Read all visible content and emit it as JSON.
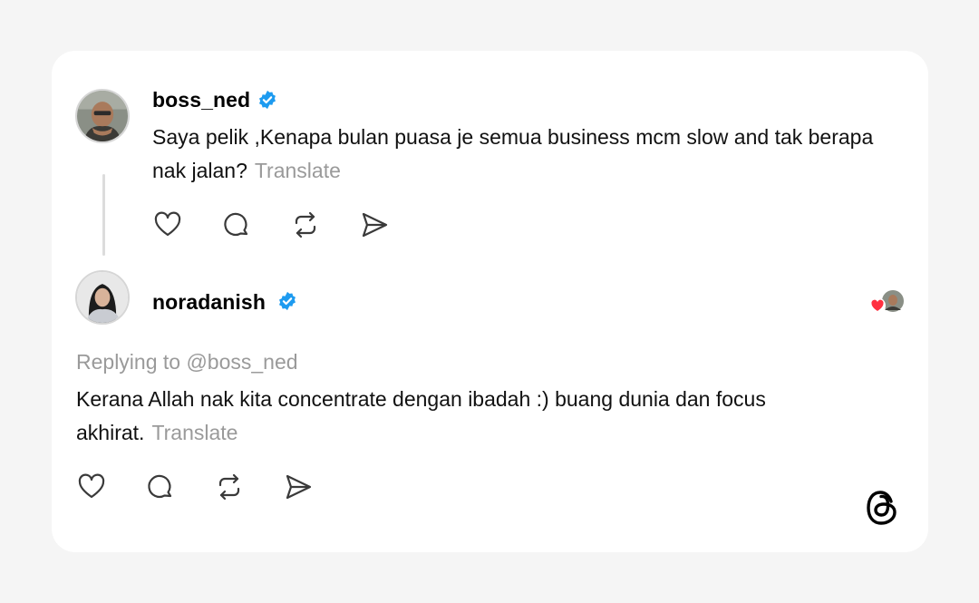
{
  "post": {
    "author": "boss_ned",
    "text": "Saya pelik ,Kenapa bulan puasa je semua business mcm slow and tak berapa nak jalan?",
    "translate_label": "Translate"
  },
  "reply": {
    "author": "noradanish",
    "replying_to": "Replying to @boss_ned",
    "text": "Kerana Allah nak kita concentrate dengan ibadah :) buang dunia dan focus akhirat.",
    "translate_label": "Translate"
  },
  "icons": {
    "verified": "verified-badge-icon",
    "like": "heart-icon",
    "comment": "comment-bubble-icon",
    "repost": "repost-icon",
    "share": "send-icon",
    "brand": "threads-logo-icon"
  },
  "colors": {
    "verified": "#1d9bf0",
    "like_badge": "#ff3040",
    "muted_text": "#9a9a9a",
    "icon_stroke": "#3a3a3a"
  }
}
